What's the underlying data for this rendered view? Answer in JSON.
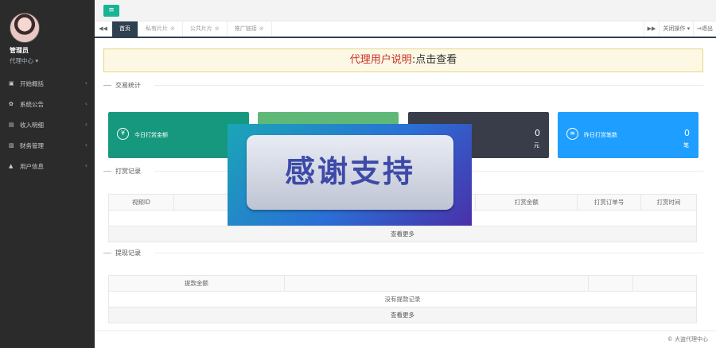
{
  "sidebar": {
    "user_name": "管理员",
    "user_role": "代理中心 ▾",
    "items": [
      {
        "icon": "dashboard-icon",
        "glyph": "▣",
        "label": "开始概括"
      },
      {
        "icon": "gear-icon",
        "glyph": "✿",
        "label": "系统公告"
      },
      {
        "icon": "list-icon",
        "glyph": "▤",
        "label": "收入明细"
      },
      {
        "icon": "finance-icon",
        "glyph": "▧",
        "label": "财务管理"
      },
      {
        "icon": "user-icon",
        "glyph": "▲",
        "label": "用户信息"
      }
    ]
  },
  "tabs": [
    {
      "label": "首页",
      "active": true
    },
    {
      "label": "私有片片",
      "closable": true
    },
    {
      "label": "公共片片",
      "closable": true
    },
    {
      "label": "推广链接",
      "closable": true
    }
  ],
  "tab_right": {
    "actions": "关闭操作 ▾",
    "logout": "⇒退出"
  },
  "notice": {
    "highlight": "代理用户说明",
    "rest": ":点击查看"
  },
  "sections": {
    "stats": "交易统计",
    "rewards": "打赏记录",
    "withdraw": "提现记录"
  },
  "cards": [
    {
      "label": "今日打赏金额",
      "glyph": "¥",
      "value": "",
      "unit": "",
      "color": "#16987e"
    },
    {
      "label": "",
      "glyph": "",
      "value": "",
      "unit": "",
      "color": "#5fb878"
    },
    {
      "label": "",
      "glyph": "",
      "value": "0",
      "unit": "元",
      "color": "#383d49"
    },
    {
      "label": "昨日打赏笔数",
      "glyph": "≡",
      "value": "0",
      "unit": "笔",
      "color": "#1e9fff"
    }
  ],
  "rewards_table": {
    "headers": [
      "视频ID",
      "",
      "",
      "",
      "打赏金额",
      "打赏订单号",
      "打赏时间"
    ],
    "more": "查看更多"
  },
  "withdraw_table": {
    "headers": [
      "提款金额",
      "",
      "",
      ""
    ],
    "empty": "没有提款记录",
    "more": "查看更多"
  },
  "overlay": {
    "text": "感谢支持"
  },
  "footer": {
    "text": "© 大盗代理中心"
  }
}
